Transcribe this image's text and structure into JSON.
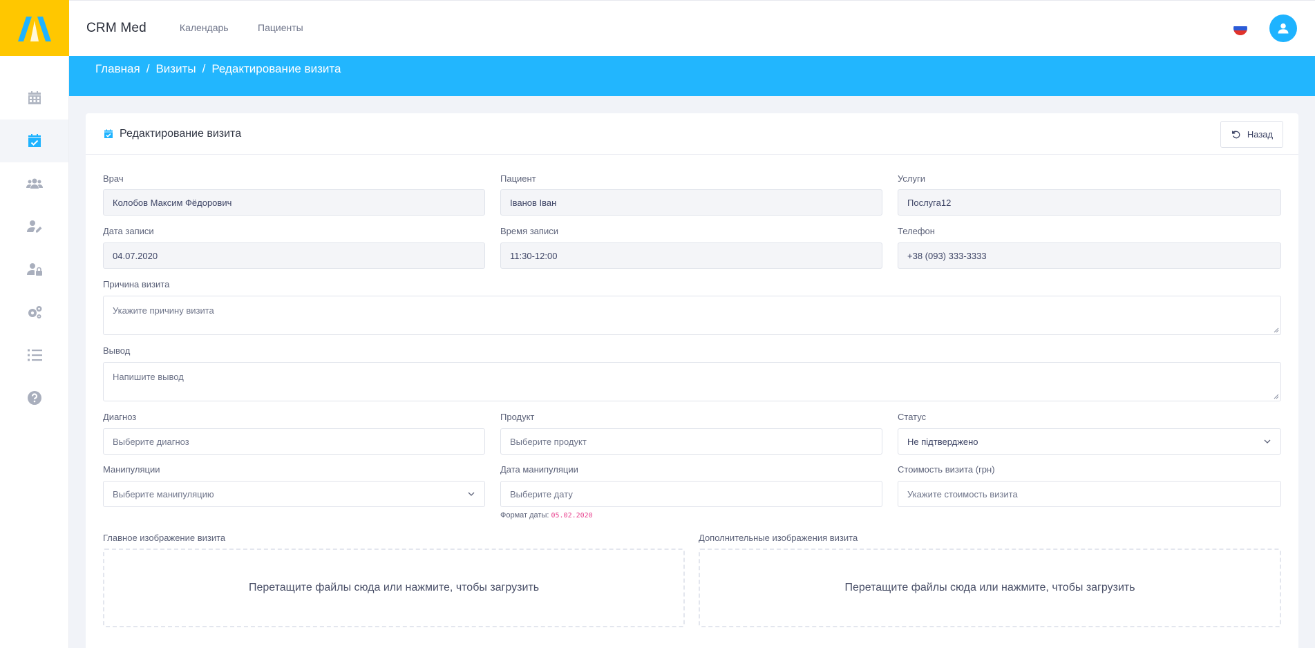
{
  "app": {
    "brand": "CRM Med"
  },
  "topnav": [
    {
      "label": "Календарь"
    },
    {
      "label": "Пациенты"
    }
  ],
  "breadcrumb": [
    {
      "label": "Главная"
    },
    {
      "label": "Визиты"
    },
    {
      "label": "Редактирование визита"
    }
  ],
  "breadcrumb_sep": "/",
  "card": {
    "title": "Редактирование визита",
    "back_label": "Назад"
  },
  "form": {
    "doctor": {
      "label": "Врач",
      "value": "Колобов Максим Фёдорович"
    },
    "patient": {
      "label": "Пациент",
      "value": "Іванов Іван"
    },
    "services": {
      "label": "Услуги",
      "value": "Послуга12"
    },
    "date": {
      "label": "Дата записи",
      "value": "04.07.2020"
    },
    "time": {
      "label": "Время записи",
      "value": "11:30-12:00"
    },
    "phone": {
      "label": "Телефон",
      "value": "+38 (093) 333-3333"
    },
    "reason": {
      "label": "Причина визита",
      "placeholder": "Укажите причину визита"
    },
    "conclusion": {
      "label": "Вывод",
      "placeholder": "Напишите вывод"
    },
    "diagnosis": {
      "label": "Диагноз",
      "placeholder": "Выберите диагноз"
    },
    "product": {
      "label": "Продукт",
      "placeholder": "Выберите продукт"
    },
    "status": {
      "label": "Статус",
      "value": "Не підтверджено"
    },
    "manipulations": {
      "label": "Манипуляции",
      "placeholder": "Выберите манипуляцию"
    },
    "manip_date": {
      "label": "Дата манипуляции",
      "placeholder": "Выберите дату",
      "hint_text": "Формат даты:",
      "hint_code": "05.02.2020"
    },
    "cost": {
      "label": "Стоимость визита (грн)",
      "placeholder": "Укажите стоимость визита"
    },
    "main_image": {
      "label": "Главное изображение визита",
      "drop_text": "Перетащите файлы сюда или нажмите, чтобы загрузить"
    },
    "extra_images": {
      "label": "Дополнительные изображения визита",
      "drop_text": "Перетащите файлы сюда или нажмите, чтобы загрузить"
    }
  },
  "sidebar": {
    "icons": [
      "calendar-icon",
      "calendar-check-icon",
      "users-icon",
      "user-edit-icon",
      "user-lock-icon",
      "gears-icon",
      "list-icon",
      "help-icon"
    ],
    "active_index": 1
  },
  "colors": {
    "accent": "#22b6fe",
    "logo_bg": "#ffc700",
    "sidebar_icon": "#a9afbd"
  }
}
